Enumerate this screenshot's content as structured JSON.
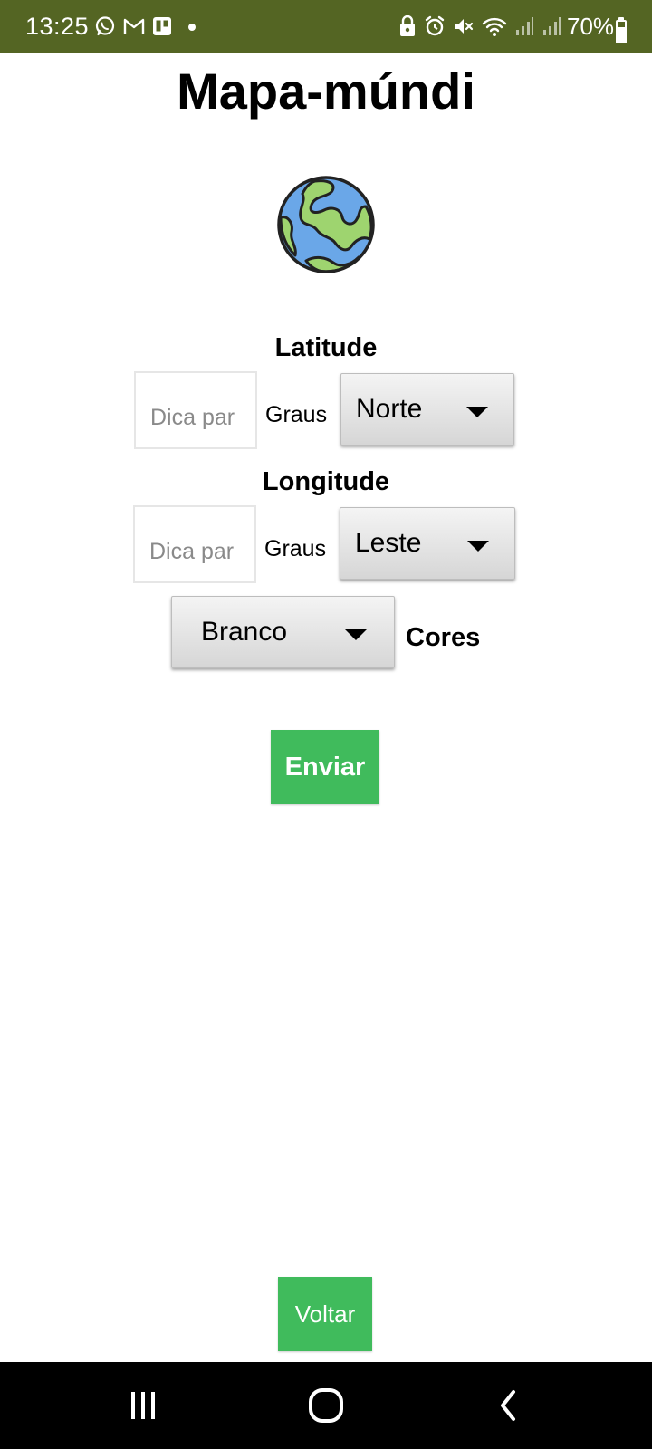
{
  "status_bar": {
    "time": "13:25",
    "battery_text": "70%",
    "battery_level": 0.7,
    "left_icons": [
      "whatsapp-icon",
      "gmail-icon",
      "trello-icon",
      "dot-icon"
    ],
    "right_icons": [
      "lock-icon",
      "alarm-icon",
      "mute-icon",
      "wifi-icon",
      "signal-icon",
      "signal-icon"
    ]
  },
  "page": {
    "title": "Mapa-múndi",
    "globe_icon": "globe-icon"
  },
  "latitude": {
    "label": "Latitude",
    "input_placeholder": "Dica par",
    "unit": "Graus",
    "direction": "Norte"
  },
  "longitude": {
    "label": "Longitude",
    "input_placeholder": "Dica par",
    "unit": "Graus",
    "direction": "Leste"
  },
  "color": {
    "selected": "Branco",
    "label": "Cores"
  },
  "buttons": {
    "submit": "Enviar",
    "back": "Voltar"
  },
  "colors": {
    "status_bar": "#546523",
    "button_green": "#40bb5c",
    "globe_ocean": "#6aa7e8",
    "globe_land": "#9ed46f"
  },
  "nav_bar": [
    "recent-apps-icon",
    "home-icon",
    "back-icon"
  ]
}
